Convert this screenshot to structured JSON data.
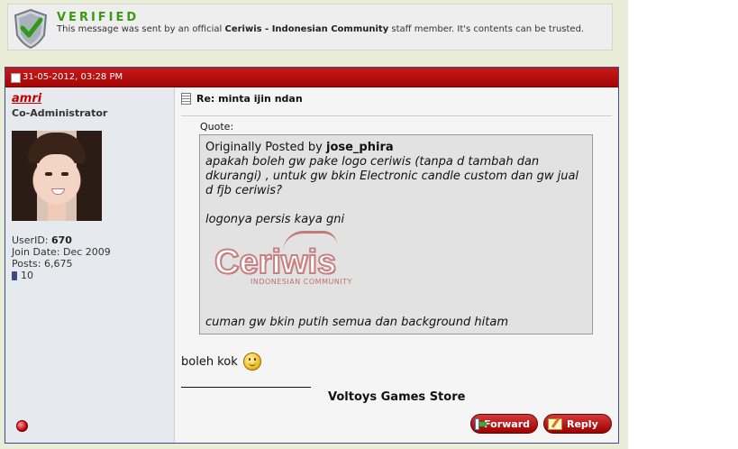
{
  "banner": {
    "title": "VERIFIED",
    "message_prefix": "This message was sent by an official",
    "community": "Ceriwis - Indonesian Community",
    "message_suffix": "staff member. It's contents can be trusted."
  },
  "post": {
    "date": "31-05-2012, 03:28 PM",
    "title": "Re: minta ijin ndan",
    "quote_label": "Quote:",
    "quote": {
      "prefix": "Originally Posted by",
      "author": "jose_phira",
      "line1": "apakah boleh gw pake logo ceriwis (tanpa d tambah dan dkurangi) , untuk gw bkin Electronic candle custom dan gw jual d fjb ceriwis?",
      "line2": "logonya persis kaya gni",
      "logo_word": "Ceriwis",
      "logo_sub": "INDONESIAN COMMUNITY",
      "line3": "cuman gw bkin putih semua dan background hitam"
    },
    "reply_text": "boleh kok",
    "signature": "Voltoys Games Store"
  },
  "user": {
    "name": "amri",
    "title": "Co-Administrator",
    "userid_label": "UserID:",
    "userid": "670",
    "join_label": "Join Date:",
    "join_date": "Dec 2009",
    "posts_label": "Posts:",
    "posts": "6,675",
    "reputation": "10"
  },
  "buttons": {
    "forward": "Forward",
    "reply": "Reply"
  },
  "colors": {
    "header_red": "#b30f0f",
    "verified_green": "#3a9a14",
    "username_red": "#c30000",
    "page_bg": "#e9ecd6"
  }
}
